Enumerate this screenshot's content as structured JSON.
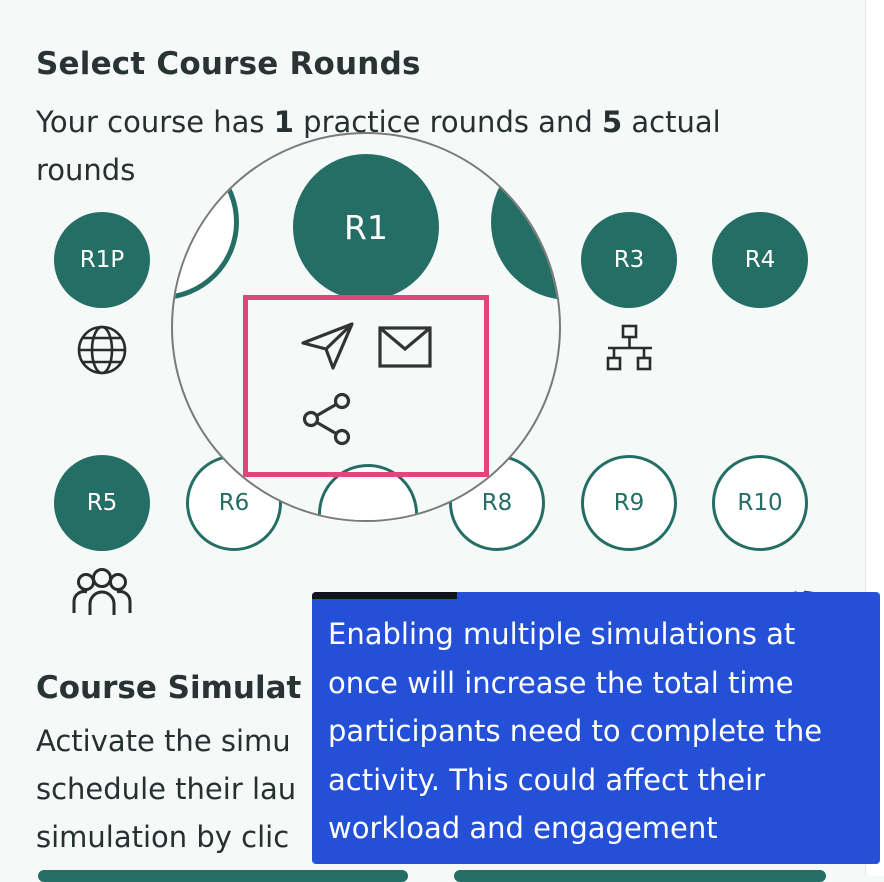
{
  "rounds_section": {
    "title": "Select Course Rounds",
    "desc_prefix": "Your course has ",
    "practice_count": "1",
    "desc_middle": " practice rounds and ",
    "actual_count": "5",
    "desc_suffix": " actual rounds"
  },
  "rounds": [
    {
      "label": "R1P",
      "state": "active",
      "icon": "globe-icon"
    },
    {
      "label": "R3",
      "state": "active",
      "icon": "network-icon"
    },
    {
      "label": "R4",
      "state": "active",
      "icon": ""
    },
    {
      "label": "R5",
      "state": "active",
      "icon": "users-icon"
    },
    {
      "label": "R6",
      "state": "inactive",
      "icon": ""
    },
    {
      "label": "R8",
      "state": "inactive",
      "icon": ""
    },
    {
      "label": "R9",
      "state": "inactive",
      "icon": ""
    },
    {
      "label": "R10",
      "state": "inactive",
      "icon": ""
    }
  ],
  "magnifier": {
    "round_label": "R1",
    "icons": [
      "send-icon",
      "mail-icon",
      "share-icon"
    ]
  },
  "tooltip": {
    "text": "Enabling multiple simulations at once will increase the total time participants need to complete the activity. This could affect their workload and engagement"
  },
  "simulation_section": {
    "title": "Course Simulat",
    "line1": "Activate the simu",
    "line2": "schedule their lau",
    "line3": "simulation by clic"
  },
  "colors": {
    "accent": "#256e65",
    "tooltip_bg": "#2350d6",
    "highlight": "#e0457b",
    "page_bg": "#f5faf9"
  }
}
